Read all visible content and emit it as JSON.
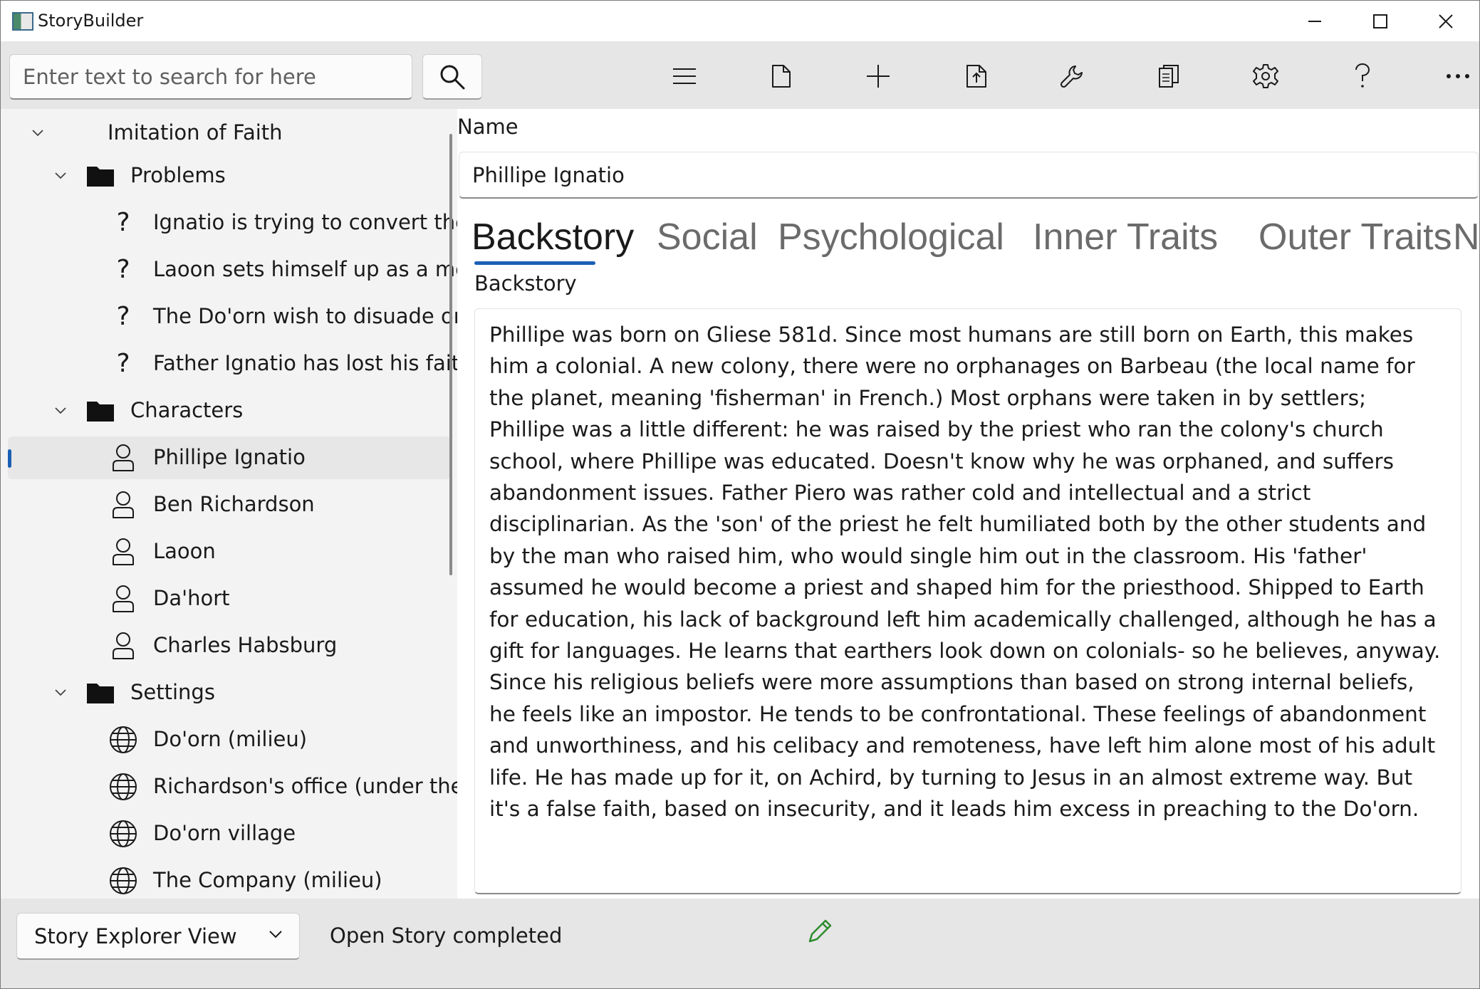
{
  "window": {
    "title": "StoryBuilder",
    "minimize_icon": "minimize-icon",
    "maximize_icon": "maximize-icon",
    "close_icon": "close-icon"
  },
  "toolbar": {
    "search_placeholder": "Enter text to search for here",
    "search_value": "",
    "buttons": [
      {
        "icon": "hamburger-menu-icon"
      },
      {
        "icon": "new-file-icon"
      },
      {
        "icon": "add-icon"
      },
      {
        "icon": "move-element-icon"
      },
      {
        "icon": "wrench-tools-icon"
      },
      {
        "icon": "copy-reports-icon"
      },
      {
        "icon": "gear-settings-icon"
      },
      {
        "icon": "help-icon"
      },
      {
        "icon": "more-options-icon"
      }
    ]
  },
  "tree": {
    "root": {
      "label": "Imitation of Faith",
      "expanded": true
    },
    "nodes": [
      {
        "label": "Problems",
        "type": "folder",
        "expanded": true,
        "level": 1
      },
      {
        "label": "Ignatio is trying to convert the",
        "type": "problem",
        "level": 2
      },
      {
        "label": "Laoon sets himself up as a mes",
        "type": "problem",
        "level": 2
      },
      {
        "label": "The Do'orn wish to disuade or",
        "type": "problem",
        "level": 2
      },
      {
        "label": "Father Ignatio has lost his faith",
        "type": "problem",
        "level": 2
      },
      {
        "label": "Characters",
        "type": "folder",
        "expanded": true,
        "level": 1
      },
      {
        "label": "Phillipe Ignatio",
        "type": "character",
        "level": 2,
        "selected": true
      },
      {
        "label": "Ben Richardson",
        "type": "character",
        "level": 2
      },
      {
        "label": "Laoon",
        "type": "character",
        "level": 2
      },
      {
        "label": "Da'hort",
        "type": "character",
        "level": 2
      },
      {
        "label": "Charles Habsburg",
        "type": "character",
        "level": 2
      },
      {
        "label": "Settings",
        "type": "folder",
        "expanded": true,
        "level": 1
      },
      {
        "label": "Do'orn (milieu)",
        "type": "setting",
        "level": 2
      },
      {
        "label": "Richardson's office (under the d",
        "type": "setting",
        "level": 2
      },
      {
        "label": "Do'orn village",
        "type": "setting",
        "level": 2
      },
      {
        "label": "The Company (milieu)",
        "type": "setting",
        "level": 2
      }
    ]
  },
  "content": {
    "name_label": "Name",
    "name_value": "Phillipe Ignatio",
    "tabs": [
      {
        "label": "Backstory",
        "active": true
      },
      {
        "label": "Social",
        "active": false
      },
      {
        "label": "Psychological",
        "active": false
      },
      {
        "label": "Inner Traits",
        "active": false
      },
      {
        "label": "Outer Traits",
        "active": false
      },
      {
        "label": "No",
        "active": false
      }
    ],
    "backstory_label": "Backstory",
    "backstory_text": "Phillipe was born on Gliese 581d. Since most humans are still born on Earth, this makes him a colonial. A new colony, there were no orphanages on Barbeau (the local name for the planet, meaning 'fisherman' in French.) Most orphans were taken in by settlers; Phillipe was a little different: he was raised by the priest who ran the colony's church school, where Phillipe was educated. Doesn't know why he was orphaned, and suffers abandonment issues. Father Piero was rather cold and intellectual and a strict disciplinarian. As the 'son' of the priest he felt humiliated both by the other students and by the man who raised him, who would single him out in the classroom. His 'father' assumed he would become a priest and shaped him for the priesthood. Shipped to Earth for education, his lack of background left him academically challenged, although he has a gift for languages. He learns that earthers look down on colonials- so he believes, anyway.  Since his religious beliefs were more assumptions than based on strong internal beliefs, he feels like an impostor. He tends to be confrontational. These feelings of abandonment and unworthiness, and his celibacy and remoteness, have left him alone most of his adult life. He has made up for it, on Achird, by turning to Jesus in an almost extreme way. But it's a false faith, based on insecurity, and it leads him excess in preaching to the Do'orn."
  },
  "statusbar": {
    "view_select_value": "Story Explorer View",
    "status_message": "Open Story completed",
    "edit_icon": "pencil-edit-icon",
    "edit_icon_color": "#2e8b2e"
  },
  "colors": {
    "accent": "#1b5fb5",
    "toolbar_bg": "#e6e6e6",
    "tree_bg": "#f3f3f3"
  }
}
